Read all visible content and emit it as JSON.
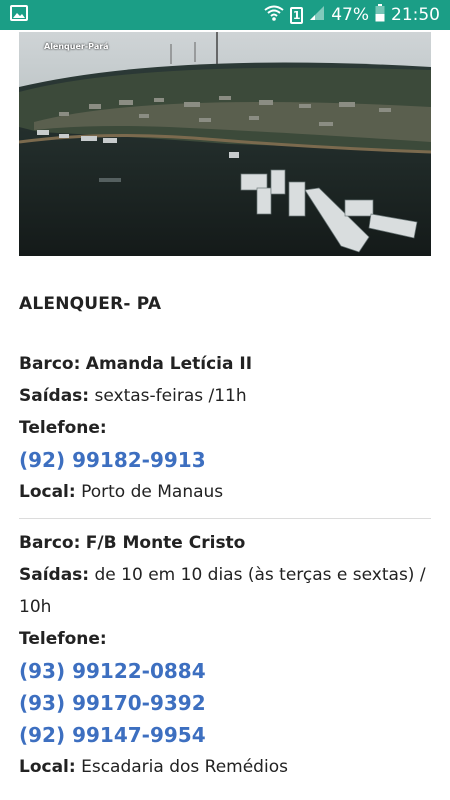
{
  "status_bar": {
    "battery": "47%",
    "time": "21:50",
    "sim_label": "1",
    "icons": [
      "image-icon",
      "wifi-icon",
      "sim-icon",
      "signal-icon",
      "battery-icon"
    ]
  },
  "hero": {
    "caption": "Alenquer-Pará"
  },
  "page": {
    "city_title": "ALENQUER- PA"
  },
  "boats": [
    {
      "name_label": "Barco:",
      "name": "Amanda Letícia II",
      "departures_label": "Saídas:",
      "departures": "sextas-feiras /11h",
      "phone_label": "Telefone:",
      "phones": [
        "(92) 99182-9913"
      ],
      "location_label": "Local:",
      "location": "Porto de Manaus"
    },
    {
      "name_label": "Barco:",
      "name": "F/B Monte Cristo",
      "departures_label": "Saídas:",
      "departures": " de 10 em 10 dias (às terças e sextas) / 10h",
      "phone_label": "Telefone:",
      "phones": [
        "(93) 99122-0884",
        "(93) 99170-9392",
        "(92) 99147-9954"
      ],
      "location_label": "Local:",
      "location": "Escadaria dos Remédios"
    }
  ],
  "colors": {
    "status_bar": "#1b9e86",
    "link": "#3d6fc0"
  }
}
